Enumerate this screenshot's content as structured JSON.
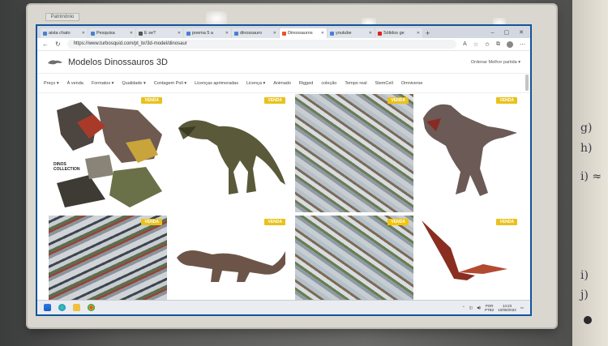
{
  "photo": {
    "sticker_text": "Patrimônio",
    "notebook_marks": [
      "g)",
      "h)",
      "i) ≈",
      "i)",
      "j)"
    ]
  },
  "browser": {
    "tabs": [
      {
        "label": "aista chato",
        "color": "#4a7fd4",
        "active": false
      },
      {
        "label": "Pesquisa",
        "color": "#4a7fd4",
        "active": false
      },
      {
        "label": "E se?",
        "color": "#555555",
        "active": false
      },
      {
        "label": "poema 5 a",
        "color": "#4a7fd4",
        "active": false
      },
      {
        "label": "dinossauro",
        "color": "#4a7fd4",
        "active": false
      },
      {
        "label": "Dinossauros",
        "color": "#e8532a",
        "active": true
      },
      {
        "label": "youtube",
        "color": "#4a7fd4",
        "active": false
      },
      {
        "label": "Sólidos ge",
        "color": "#e02020",
        "active": false
      }
    ],
    "new_tab": "+",
    "window_controls": [
      "–",
      "▢",
      "✕"
    ],
    "url": "https://www.turbosquid.com/pt_br/3d-model/dinosaur"
  },
  "site": {
    "title": "Modelos Dinossauros 3D",
    "sort_label": "Ordenar Melhor partida ▾",
    "filters": [
      "Preço ▾",
      "À venda",
      "Formatos ▾",
      "Qualidade ▾",
      "Contagem Poli ▾",
      "Licenças aprimoradas",
      "Licença ▾",
      "Animado",
      "Rigged",
      "coleção",
      "Tempo real",
      "StemCell",
      "Omniverse"
    ],
    "badge_text": "VENDA",
    "collection_label_line1": "DINOS",
    "collection_label_line2": "COLLECTION"
  },
  "taskbar": {
    "lang": "POR",
    "lang2": "PTB2",
    "time": "14:23",
    "date": "10/08/2022"
  },
  "colors": {
    "accent": "#12539c",
    "badge": "#e8c21a",
    "trex_green": "#5a5a3a",
    "trex_gray": "#6b5a55"
  }
}
